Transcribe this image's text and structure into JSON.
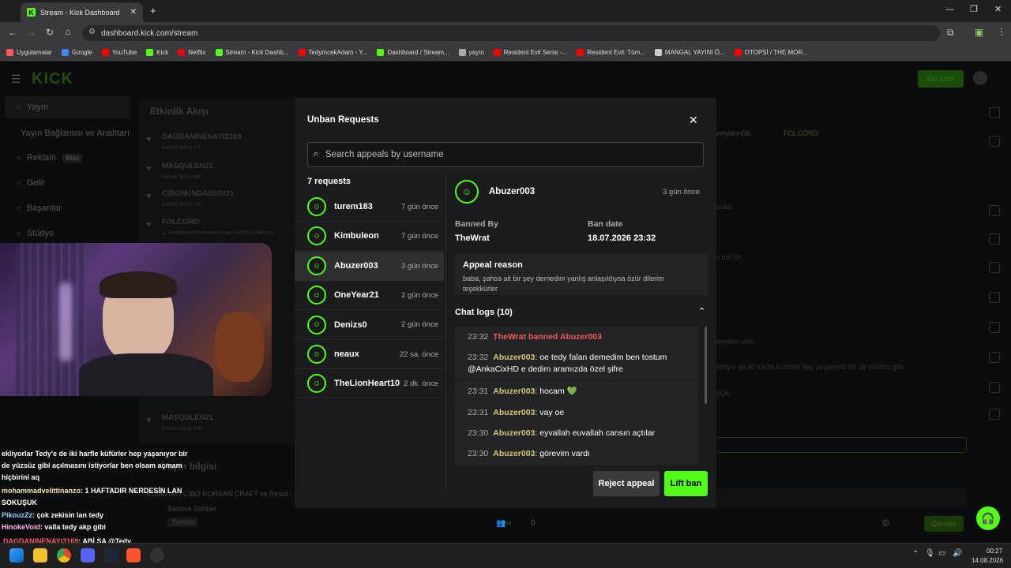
{
  "browser": {
    "tab_title": "Stream - Kick Dashboard",
    "url": "dashboard.kick.com/stream",
    "bookmarks": [
      {
        "label": "Uygulamalar",
        "color": "#ff5555"
      },
      {
        "label": "Google",
        "color": "#4285f4"
      },
      {
        "label": "YouTube",
        "color": "#ff0000"
      },
      {
        "label": "Kick",
        "color": "#53fc18"
      },
      {
        "label": "Netflix",
        "color": "#e50914"
      },
      {
        "label": "Stream - Kick Dashb...",
        "color": "#53fc18"
      },
      {
        "label": "TedymcekAdam - Y...",
        "color": "#ff0000"
      },
      {
        "label": "Dashboard / Stream...",
        "color": "#53fc18"
      },
      {
        "label": "yayın",
        "color": "#aaaaaa"
      },
      {
        "label": "Resident Evil Serisi -...",
        "color": "#ff0000"
      },
      {
        "label": "Resident Evil: Tüm...",
        "color": "#ff0000"
      },
      {
        "label": "MANGAL YAYINI Ö...",
        "color": "#cccccc"
      },
      {
        "label": "OTOPSİ / THE MOR...",
        "color": "#ff0000"
      }
    ]
  },
  "dashboard": {
    "go_live": "Go Live",
    "sidebar": [
      {
        "label": "Yayın",
        "icon": "broadcast-icon"
      },
      {
        "label": "Yayın Bağlantısı ve Anahtarı",
        "icon": ""
      },
      {
        "label": "Reklam",
        "icon": "ad-icon",
        "badge": "Beta"
      },
      {
        "label": "Gelir",
        "icon": "wallet-icon"
      },
      {
        "label": "Başarılar",
        "icon": "trophy-icon"
      },
      {
        "label": "Stüdyo",
        "icon": "studio-icon"
      }
    ],
    "activity_title": "Etkinlik Akışı",
    "activity": [
      {
        "name": "DAGDANINENAYI3169",
        "sub": "kanalı takip etti"
      },
      {
        "name": "MASQULEN21",
        "sub": "kanalı takip etti"
      },
      {
        "name": "CIBONUNDASSGI21",
        "sub": "kanalı takip etti"
      },
      {
        "name": "FOLCORD",
        "sub": "1. amiryasinburhanelensari isimli kullanıcıy..."
      },
      {
        "name": "MASQULEN21",
        "sub": "kanalı takip etti"
      }
    ],
    "stream_info_title": "Yayın bilgisi",
    "stream_title": "KOMUTAN CİBO KORSAN CRAFT ve Resid...",
    "category": "Sadece Sohbet",
    "language": "Turkish",
    "send_label": "Gönder",
    "viewer_count": "0",
    "chat_user": "ysfyldrm56",
    "chat_badge": "FOLCORD",
    "chat_snips": [
      "erata",
      "n milf of",
      "nnettim ohh",
      "Tedy'e de iki harfle küfürler hep yaşanıyor bir de yüzsüz gibi",
      "ŞUK"
    ]
  },
  "overlay_chat": [
    {
      "user": "",
      "text": "ekliyorlar Tedy'e de iki harfle küfürler hep yaşanıyor bir de yüzsüz gibi açılmasını istiyorlar ben olsam açmam hiçbirini aq",
      "color": "#ffffff"
    },
    {
      "user": "mohammadvelittinanzo",
      "text": ": 1 HAFTADIR NERDESİN LAN SOKUŞUK",
      "color": "#f5e7a1"
    },
    {
      "user": "PikouzZz",
      "text": ": çok zekisin lan tedy",
      "color": "#8fd3ff"
    },
    {
      "user": "HinokeVoid",
      "text": ": valla tedy akp gibi",
      "color": "#ffb3e6"
    },
    {
      "user": "DAGDANINENAYI3169",
      "text": ": ABİ SA @Tedy",
      "color": "#ff5d5d"
    }
  ],
  "modal": {
    "title": "Unban Requests",
    "search_placeholder": "Search appeals by username",
    "request_count": "7 requests",
    "requests": [
      {
        "name": "turem183",
        "time": "7 gün önce"
      },
      {
        "name": "Kimbuleon",
        "time": "7 gün önce"
      },
      {
        "name": "Abuzer003",
        "time": "3 gün önce"
      },
      {
        "name": "OneYear21",
        "time": "2 gün önce"
      },
      {
        "name": "Denizs0",
        "time": "2 gün önce"
      },
      {
        "name": "neaux",
        "time": "22 sa. önce"
      },
      {
        "name": "TheLionHeart10",
        "time": "2 dk. önce"
      }
    ],
    "selected": {
      "name": "Abuzer003",
      "time": "3 gün önce",
      "banned_by_label": "Banned By",
      "banned_by": "TheWrat",
      "ban_date_label": "Ban date",
      "ban_date": "18.07.2026 23:32",
      "appeal_label": "Appeal reason",
      "appeal_text": "baba, şahsa ait bir şey demedim yanlış anlaşıldıysa özür dilerim teşekkürler",
      "chat_logs_label": "Chat logs (10)",
      "logs": [
        {
          "time": "23:32",
          "user": "",
          "text": "TheWrat banned Abuzer003",
          "system": true
        },
        {
          "time": "23:32",
          "user": "Abuzer003",
          "text": ": oe tedy falan demedim ben tostum @AnkaCixHD e dedim aramızda özel şifre"
        },
        {
          "time": "23:31",
          "user": "Abuzer003",
          "text": ": hocam 💚"
        },
        {
          "time": "23:31",
          "user": "Abuzer003",
          "text": ": vay oe"
        },
        {
          "time": "23:30",
          "user": "Abuzer003",
          "text": ": eyvallah euvallah cansın açtılar"
        },
        {
          "time": "23:30",
          "user": "Abuzer003",
          "text": ": görevim vardı"
        }
      ]
    },
    "reject_label": "Reject appeal",
    "lift_label": "Lift ban"
  },
  "taskbar": {
    "time": "00:27",
    "date": "14.08.2026"
  },
  "colors": {
    "accent": "#53fc18",
    "danger": "#f05a5a",
    "username": "#d9c47a"
  }
}
